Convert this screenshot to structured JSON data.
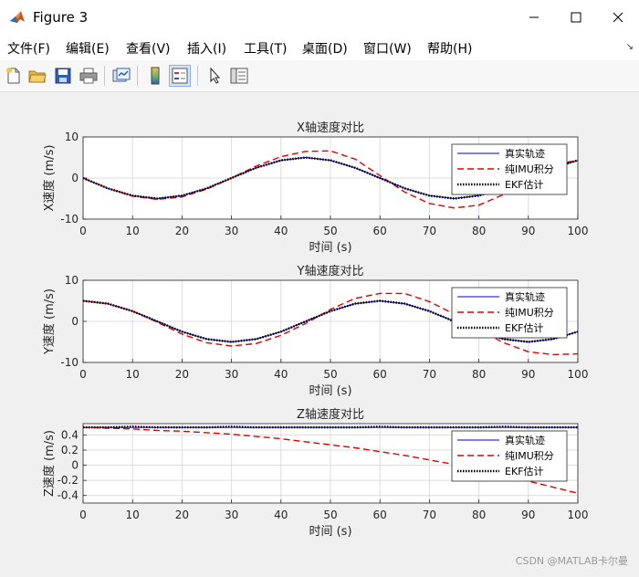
{
  "window": {
    "title": "Figure 3",
    "menu": [
      "文件(F)",
      "编辑(E)",
      "查看(V)",
      "插入(I)",
      "工具(T)",
      "桌面(D)",
      "窗口(W)",
      "帮助(H)"
    ]
  },
  "toolbar": {
    "icons": [
      "new-figure-icon",
      "open-file-icon",
      "save-icon",
      "print-icon",
      "link-plot-icon",
      "colorbar-icon",
      "legend-icon",
      "pointer-icon",
      "property-inspector-icon"
    ]
  },
  "watermark": "CSDN @MATLAB卡尔曼",
  "colors": {
    "true": "#0000c8",
    "imu": "#e00000",
    "ekf": "#000000"
  },
  "chart_data": [
    {
      "type": "line",
      "title": "X轴速度对比",
      "xlabel": "时间 (s)",
      "ylabel": "X速度 (m/s)",
      "xlim": [
        0,
        100
      ],
      "ylim": [
        -10,
        10
      ],
      "xticks": [
        0,
        10,
        20,
        30,
        40,
        50,
        60,
        70,
        80,
        90,
        100
      ],
      "yticks": [
        -10,
        0,
        10
      ],
      "grid": true,
      "legend_position": "top-right",
      "x": [
        0,
        5,
        10,
        15,
        20,
        25,
        30,
        35,
        40,
        45,
        50,
        55,
        60,
        65,
        70,
        75,
        80,
        85,
        90,
        95,
        100
      ],
      "series": [
        {
          "name": "真实轨迹",
          "style": "solid",
          "values": [
            0,
            -2.5,
            -4.3,
            -5.0,
            -4.3,
            -2.5,
            0,
            2.5,
            4.3,
            5.0,
            4.3,
            2.5,
            0,
            -2.5,
            -4.3,
            -5.0,
            -4.3,
            -2.5,
            0,
            2.5,
            4.3
          ]
        },
        {
          "name": "纯IMU积分",
          "style": "dashed",
          "values": [
            0,
            -2.5,
            -4.4,
            -5.2,
            -4.6,
            -2.7,
            0,
            2.9,
            5.2,
            6.5,
            6.6,
            4.6,
            0.6,
            -3.4,
            -6.2,
            -7.3,
            -6.6,
            -4.0,
            0,
            3.5,
            4.2
          ]
        },
        {
          "name": "EKF估计",
          "style": "dotted",
          "values": [
            0,
            -2.5,
            -4.3,
            -5.0,
            -4.3,
            -2.5,
            0,
            2.5,
            4.3,
            5.0,
            4.3,
            2.5,
            0,
            -2.5,
            -4.3,
            -5.0,
            -4.3,
            -2.5,
            0,
            2.5,
            4.3
          ]
        }
      ]
    },
    {
      "type": "line",
      "title": "Y轴速度对比",
      "xlabel": "时间 (s)",
      "ylabel": "Y速度 (m/s)",
      "xlim": [
        0,
        100
      ],
      "ylim": [
        -10,
        10
      ],
      "xticks": [
        0,
        10,
        20,
        30,
        40,
        50,
        60,
        70,
        80,
        90,
        100
      ],
      "yticks": [
        -10,
        0,
        10
      ],
      "grid": true,
      "legend_position": "top-right",
      "x": [
        0,
        5,
        10,
        15,
        20,
        25,
        30,
        35,
        40,
        45,
        50,
        55,
        60,
        65,
        70,
        75,
        80,
        85,
        90,
        95,
        100
      ],
      "series": [
        {
          "name": "真实轨迹",
          "style": "solid",
          "values": [
            5.0,
            4.3,
            2.5,
            0,
            -2.5,
            -4.3,
            -5.0,
            -4.3,
            -2.5,
            0,
            2.5,
            4.3,
            5.0,
            4.3,
            2.5,
            0,
            -2.5,
            -4.3,
            -5.0,
            -4.3,
            -2.5
          ]
        },
        {
          "name": "纯IMU积分",
          "style": "dashed",
          "values": [
            5.0,
            4.3,
            2.5,
            -0.2,
            -3.1,
            -5.2,
            -6.0,
            -5.4,
            -3.4,
            -0.5,
            2.9,
            5.6,
            6.8,
            6.8,
            4.8,
            1.8,
            -2.0,
            -5.2,
            -7.4,
            -8.1,
            -7.9
          ]
        },
        {
          "name": "EKF估计",
          "style": "dotted",
          "values": [
            5.0,
            4.3,
            2.5,
            0,
            -2.5,
            -4.3,
            -5.0,
            -4.3,
            -2.5,
            0,
            2.5,
            4.3,
            5.0,
            4.3,
            2.5,
            0,
            -2.5,
            -4.3,
            -5.0,
            -4.3,
            -2.5
          ]
        }
      ]
    },
    {
      "type": "line",
      "title": "Z轴速度对比",
      "xlabel": "时间 (s)",
      "ylabel": "Z速度 (m/s)",
      "xlim": [
        0,
        100
      ],
      "ylim": [
        -0.5,
        0.55
      ],
      "xticks": [
        0,
        10,
        20,
        30,
        40,
        50,
        60,
        70,
        80,
        90,
        100
      ],
      "yticks": [
        0.4,
        0.2,
        0,
        -0.2,
        -0.4
      ],
      "ytick_labels": [
        "0.4",
        "0.2",
        "0",
        "-0.2",
        "-0.4"
      ],
      "grid": true,
      "legend_position": "top-right",
      "x": [
        0,
        5,
        10,
        15,
        20,
        25,
        30,
        35,
        40,
        45,
        50,
        55,
        60,
        65,
        70,
        75,
        80,
        85,
        90,
        95,
        100
      ],
      "series": [
        {
          "name": "真实轨迹",
          "style": "solid",
          "values": [
            0.5,
            0.5,
            0.5,
            0.5,
            0.5,
            0.5,
            0.5,
            0.5,
            0.5,
            0.5,
            0.5,
            0.5,
            0.5,
            0.5,
            0.5,
            0.5,
            0.5,
            0.5,
            0.5,
            0.5,
            0.5
          ]
        },
        {
          "name": "纯IMU积分",
          "style": "dashed",
          "values": [
            0.5,
            0.49,
            0.48,
            0.46,
            0.45,
            0.43,
            0.41,
            0.38,
            0.35,
            0.31,
            0.27,
            0.23,
            0.18,
            0.13,
            0.07,
            0.01,
            -0.06,
            -0.13,
            -0.21,
            -0.29,
            -0.37
          ]
        },
        {
          "name": "EKF估计",
          "style": "dotted",
          "values": [
            0.5,
            0.5,
            0.51,
            0.5,
            0.5,
            0.5,
            0.51,
            0.5,
            0.5,
            0.5,
            0.5,
            0.5,
            0.51,
            0.5,
            0.5,
            0.5,
            0.5,
            0.51,
            0.5,
            0.5,
            0.5
          ]
        }
      ]
    }
  ]
}
